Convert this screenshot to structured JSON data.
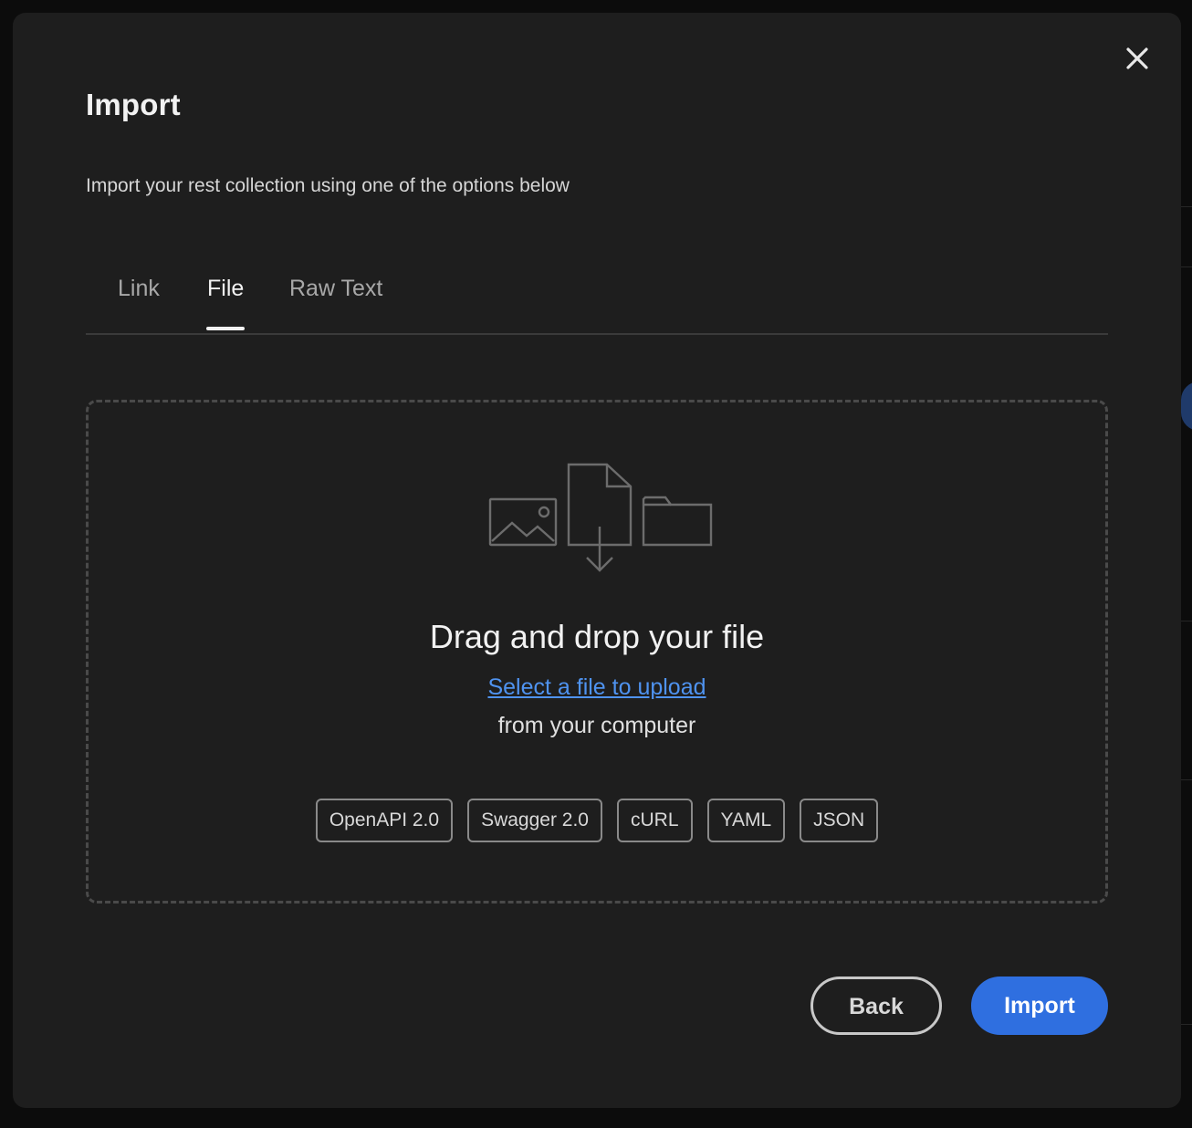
{
  "modal": {
    "title": "Import",
    "subtitle": "Import your rest collection using one of the options below",
    "close_icon": "close-icon"
  },
  "tabs": [
    {
      "label": "Link",
      "active": false
    },
    {
      "label": "File",
      "active": true
    },
    {
      "label": "Raw Text",
      "active": false
    }
  ],
  "dropzone": {
    "illustration": "file-upload-illustration-icon",
    "title": "Drag and drop your file",
    "select_link": "Select a file to upload",
    "from_text": "from your computer",
    "formats": [
      "OpenAPI 2.0",
      "Swagger 2.0",
      "cURL",
      "YAML",
      "JSON"
    ]
  },
  "footer": {
    "back_label": "Back",
    "import_label": "Import"
  },
  "colors": {
    "modal_bg": "#1e1e1e",
    "accent": "#2f6fe0",
    "link": "#4f93f0"
  }
}
